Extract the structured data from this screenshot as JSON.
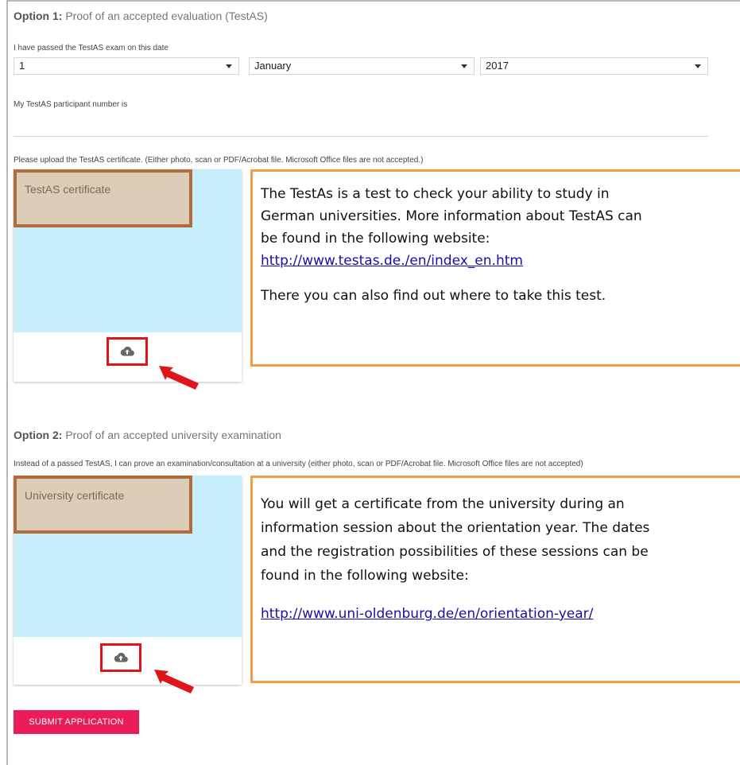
{
  "option1": {
    "label": "Option 1:",
    "title": "Proof of an accepted evaluation (TestAS)",
    "date_prompt": "I have passed the TestAS exam on this date",
    "day": "1",
    "month": "January",
    "year": "2017",
    "participant_prompt": "My TestAS participant number is",
    "participant_value": "",
    "upload_prompt": "Please upload the TestAS certificate. (Either photo, scan or PDF/Acrobat file. Microsoft Office files are not accepted.)",
    "card_label": "TestAS certificate",
    "callout": {
      "line1": "The TestAs is a test to check your ability to study in",
      "line2": "German universities. More information about TestAS can",
      "line3": "be found in the following website:",
      "link": "http://www.testas.de./en/index_en.htm",
      "line5": "There you can also find out where to take this test."
    }
  },
  "option2": {
    "label": "Option 2:",
    "title": "Proof of an accepted university examination",
    "upload_prompt": "Instead of a passed TestAS, I can prove an examination/consultation at a university (either photo, scan or PDF/Acrobat file. Microsoft Office files are not accepted)",
    "card_label": "University certificate",
    "callout": {
      "line1": "You will get a certificate from the university during an",
      "line2": "information session about the orientation year. The dates",
      "line3": "and the registration possibilities of these sessions can be",
      "line4": "found in the following website:",
      "link": "http://www.uni-oldenburg.de/en/orientation-year/"
    }
  },
  "submit_label": "SUBMIT APPLICATION",
  "icons": {
    "upload": "cloud-upload-icon",
    "arrow": "red-arrow-icon"
  },
  "colors": {
    "accent": "#ec1c5a",
    "card_bg": "#c8eefb",
    "callout_border": "#f79c44",
    "highlight": "#e0141b"
  }
}
